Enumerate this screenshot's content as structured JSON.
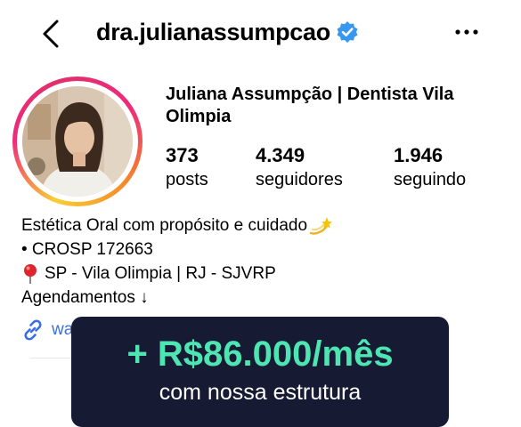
{
  "header": {
    "username": "dra.julianassumpcao",
    "back_icon": "chevron-left-icon",
    "verified_icon": "verified-badge-icon",
    "more_icon": "more-horizontal-icon"
  },
  "profile": {
    "name": "Juliana Assumpção | Dentista Vila Olimpia",
    "stats": [
      {
        "value": "373",
        "label": "posts"
      },
      {
        "value": "4.349",
        "label": "seguidores"
      },
      {
        "value": "1.946",
        "label": "seguindo"
      }
    ],
    "bio_lines": [
      "Estética Oral com propósito e cuidado",
      "• CROSP 172663",
      "SP - Vila Olimpia | RJ - SJVRP",
      "Agendamentos ↓"
    ],
    "bio_icons": [
      "dizzy-star-emoji",
      "round-pushpin-emoji"
    ],
    "link": {
      "icon": "link-icon",
      "text": "wa"
    }
  },
  "promo": {
    "title": "+ R$86.000/mês",
    "subtitle": "com nossa estrutura",
    "accent": "#4ee5b3",
    "background": "#161a33"
  },
  "colors": {
    "verified": "#3897f0",
    "link": "#3b6fe0"
  }
}
